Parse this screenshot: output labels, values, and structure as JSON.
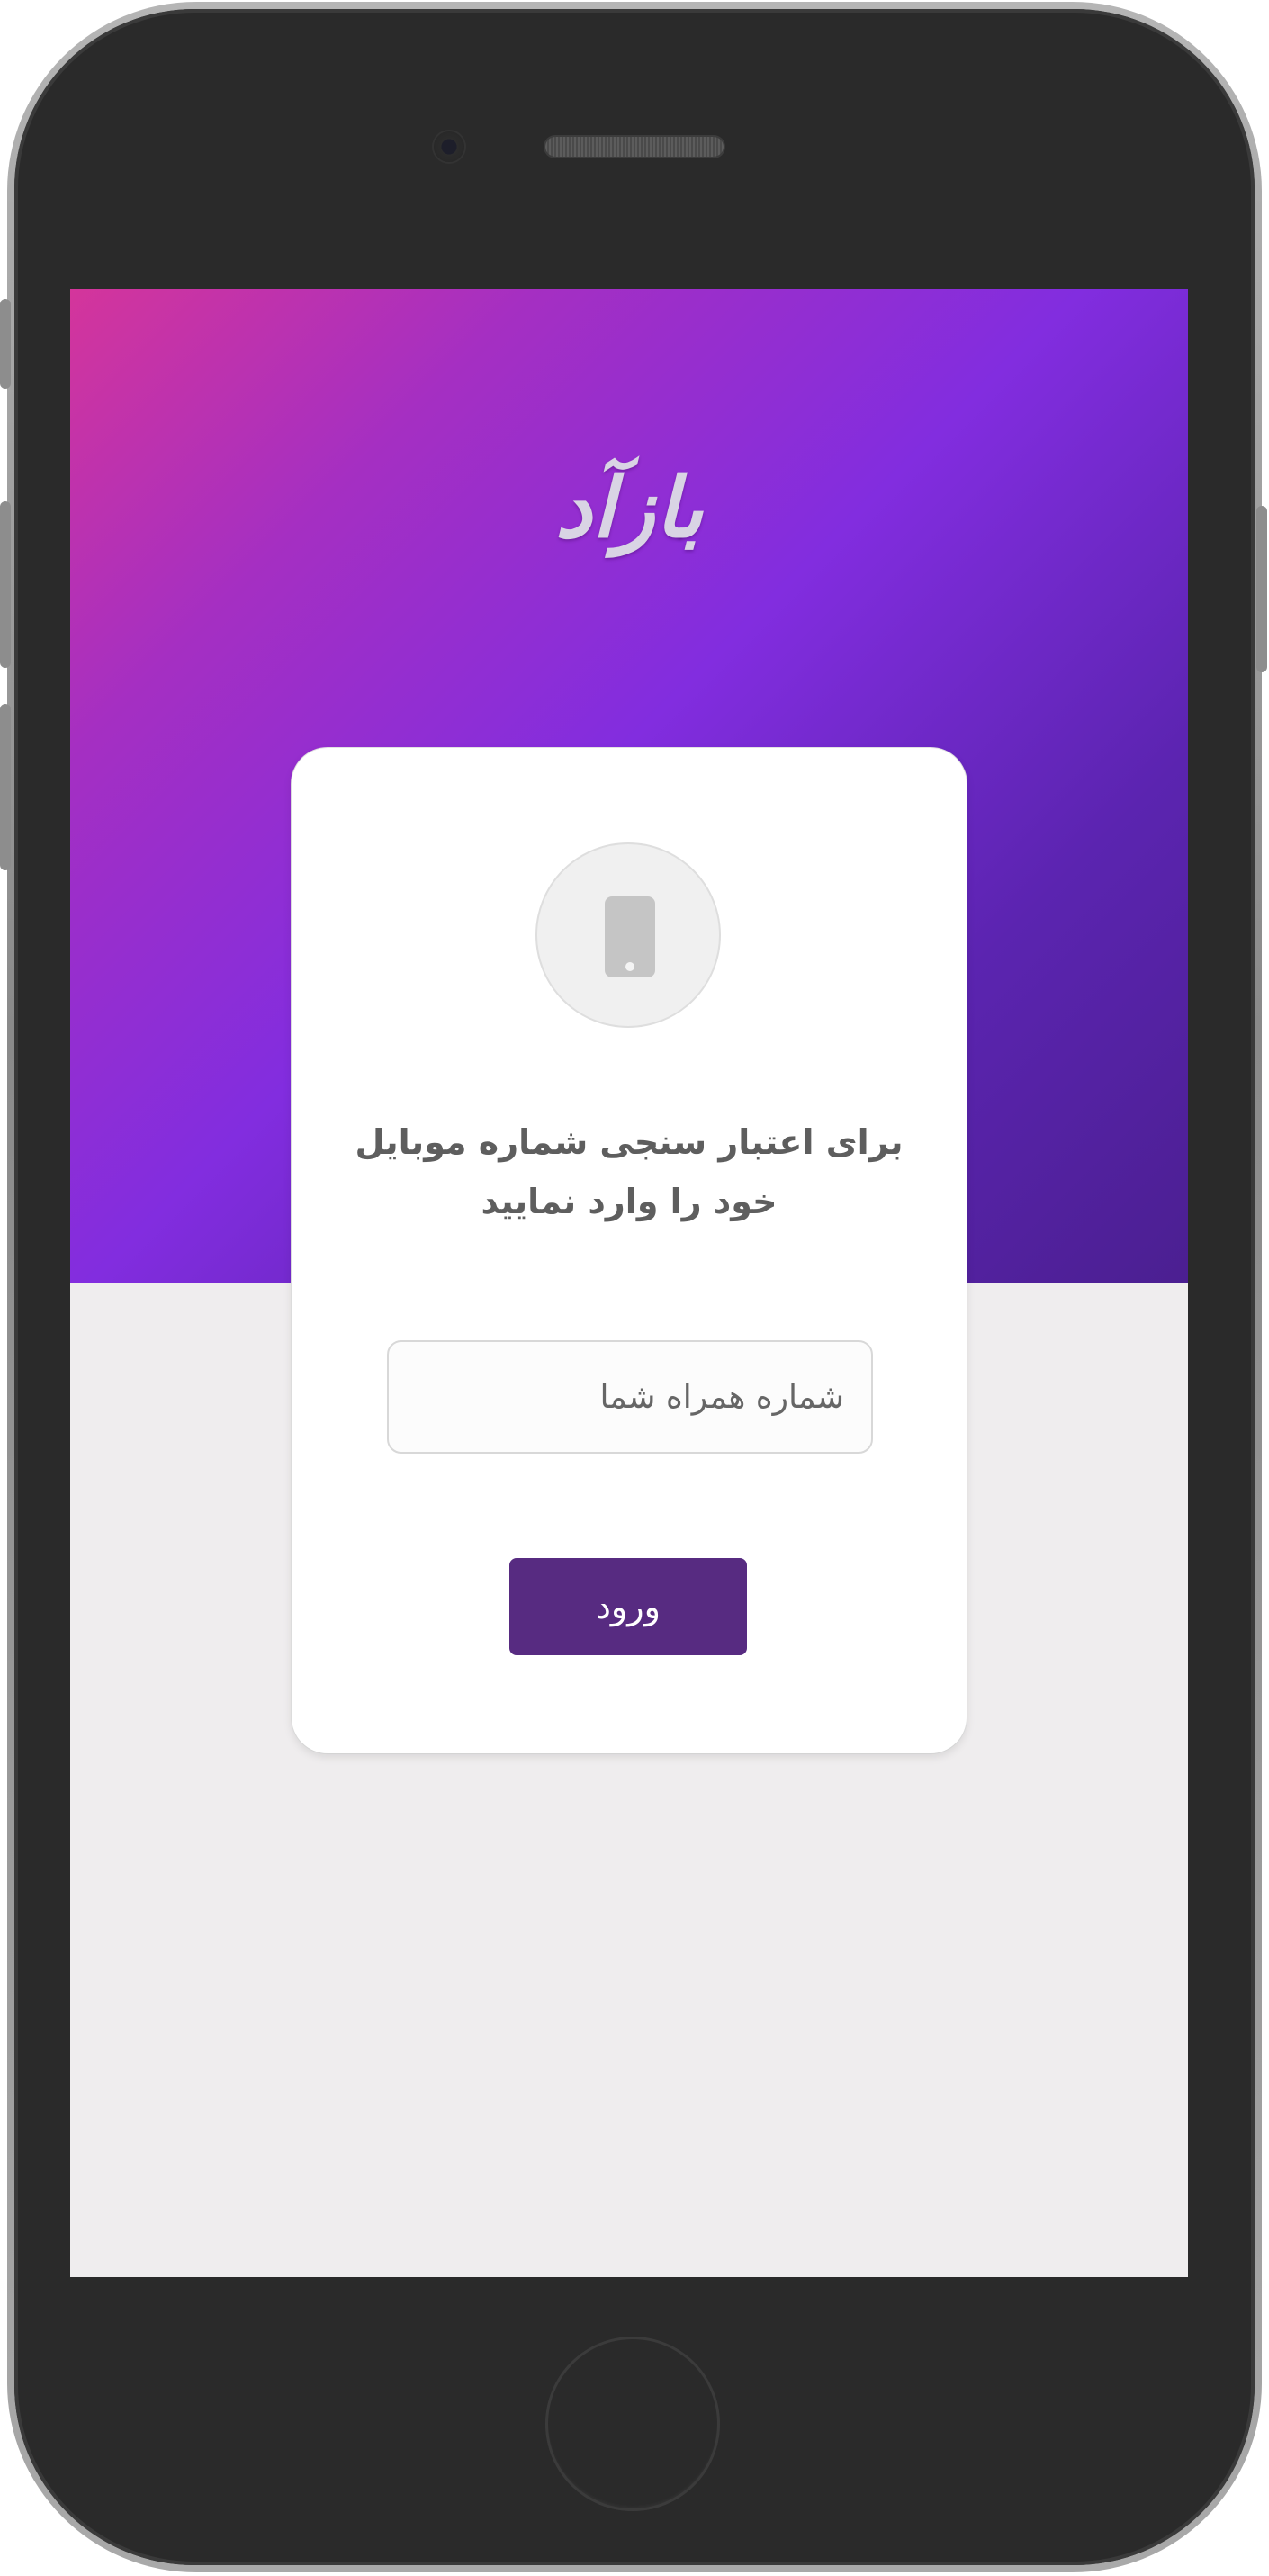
{
  "app": {
    "logo_text": "بازآد"
  },
  "login_card": {
    "icon": "mobile-phone-icon",
    "title_line1": "برای اعتبار سنجی شماره موبایل",
    "title_line2": "خود را وارد نمایید",
    "phone_input": {
      "value": "",
      "placeholder": "شماره همراه شما"
    },
    "submit_label": "ورود"
  },
  "colors": {
    "header_gradient_start": "#d4359b",
    "header_gradient_mid": "#822ddf",
    "header_gradient_end": "#4b1f91",
    "button": "#572b81",
    "screen_background": "#efedee",
    "card_background": "#ffffff"
  }
}
